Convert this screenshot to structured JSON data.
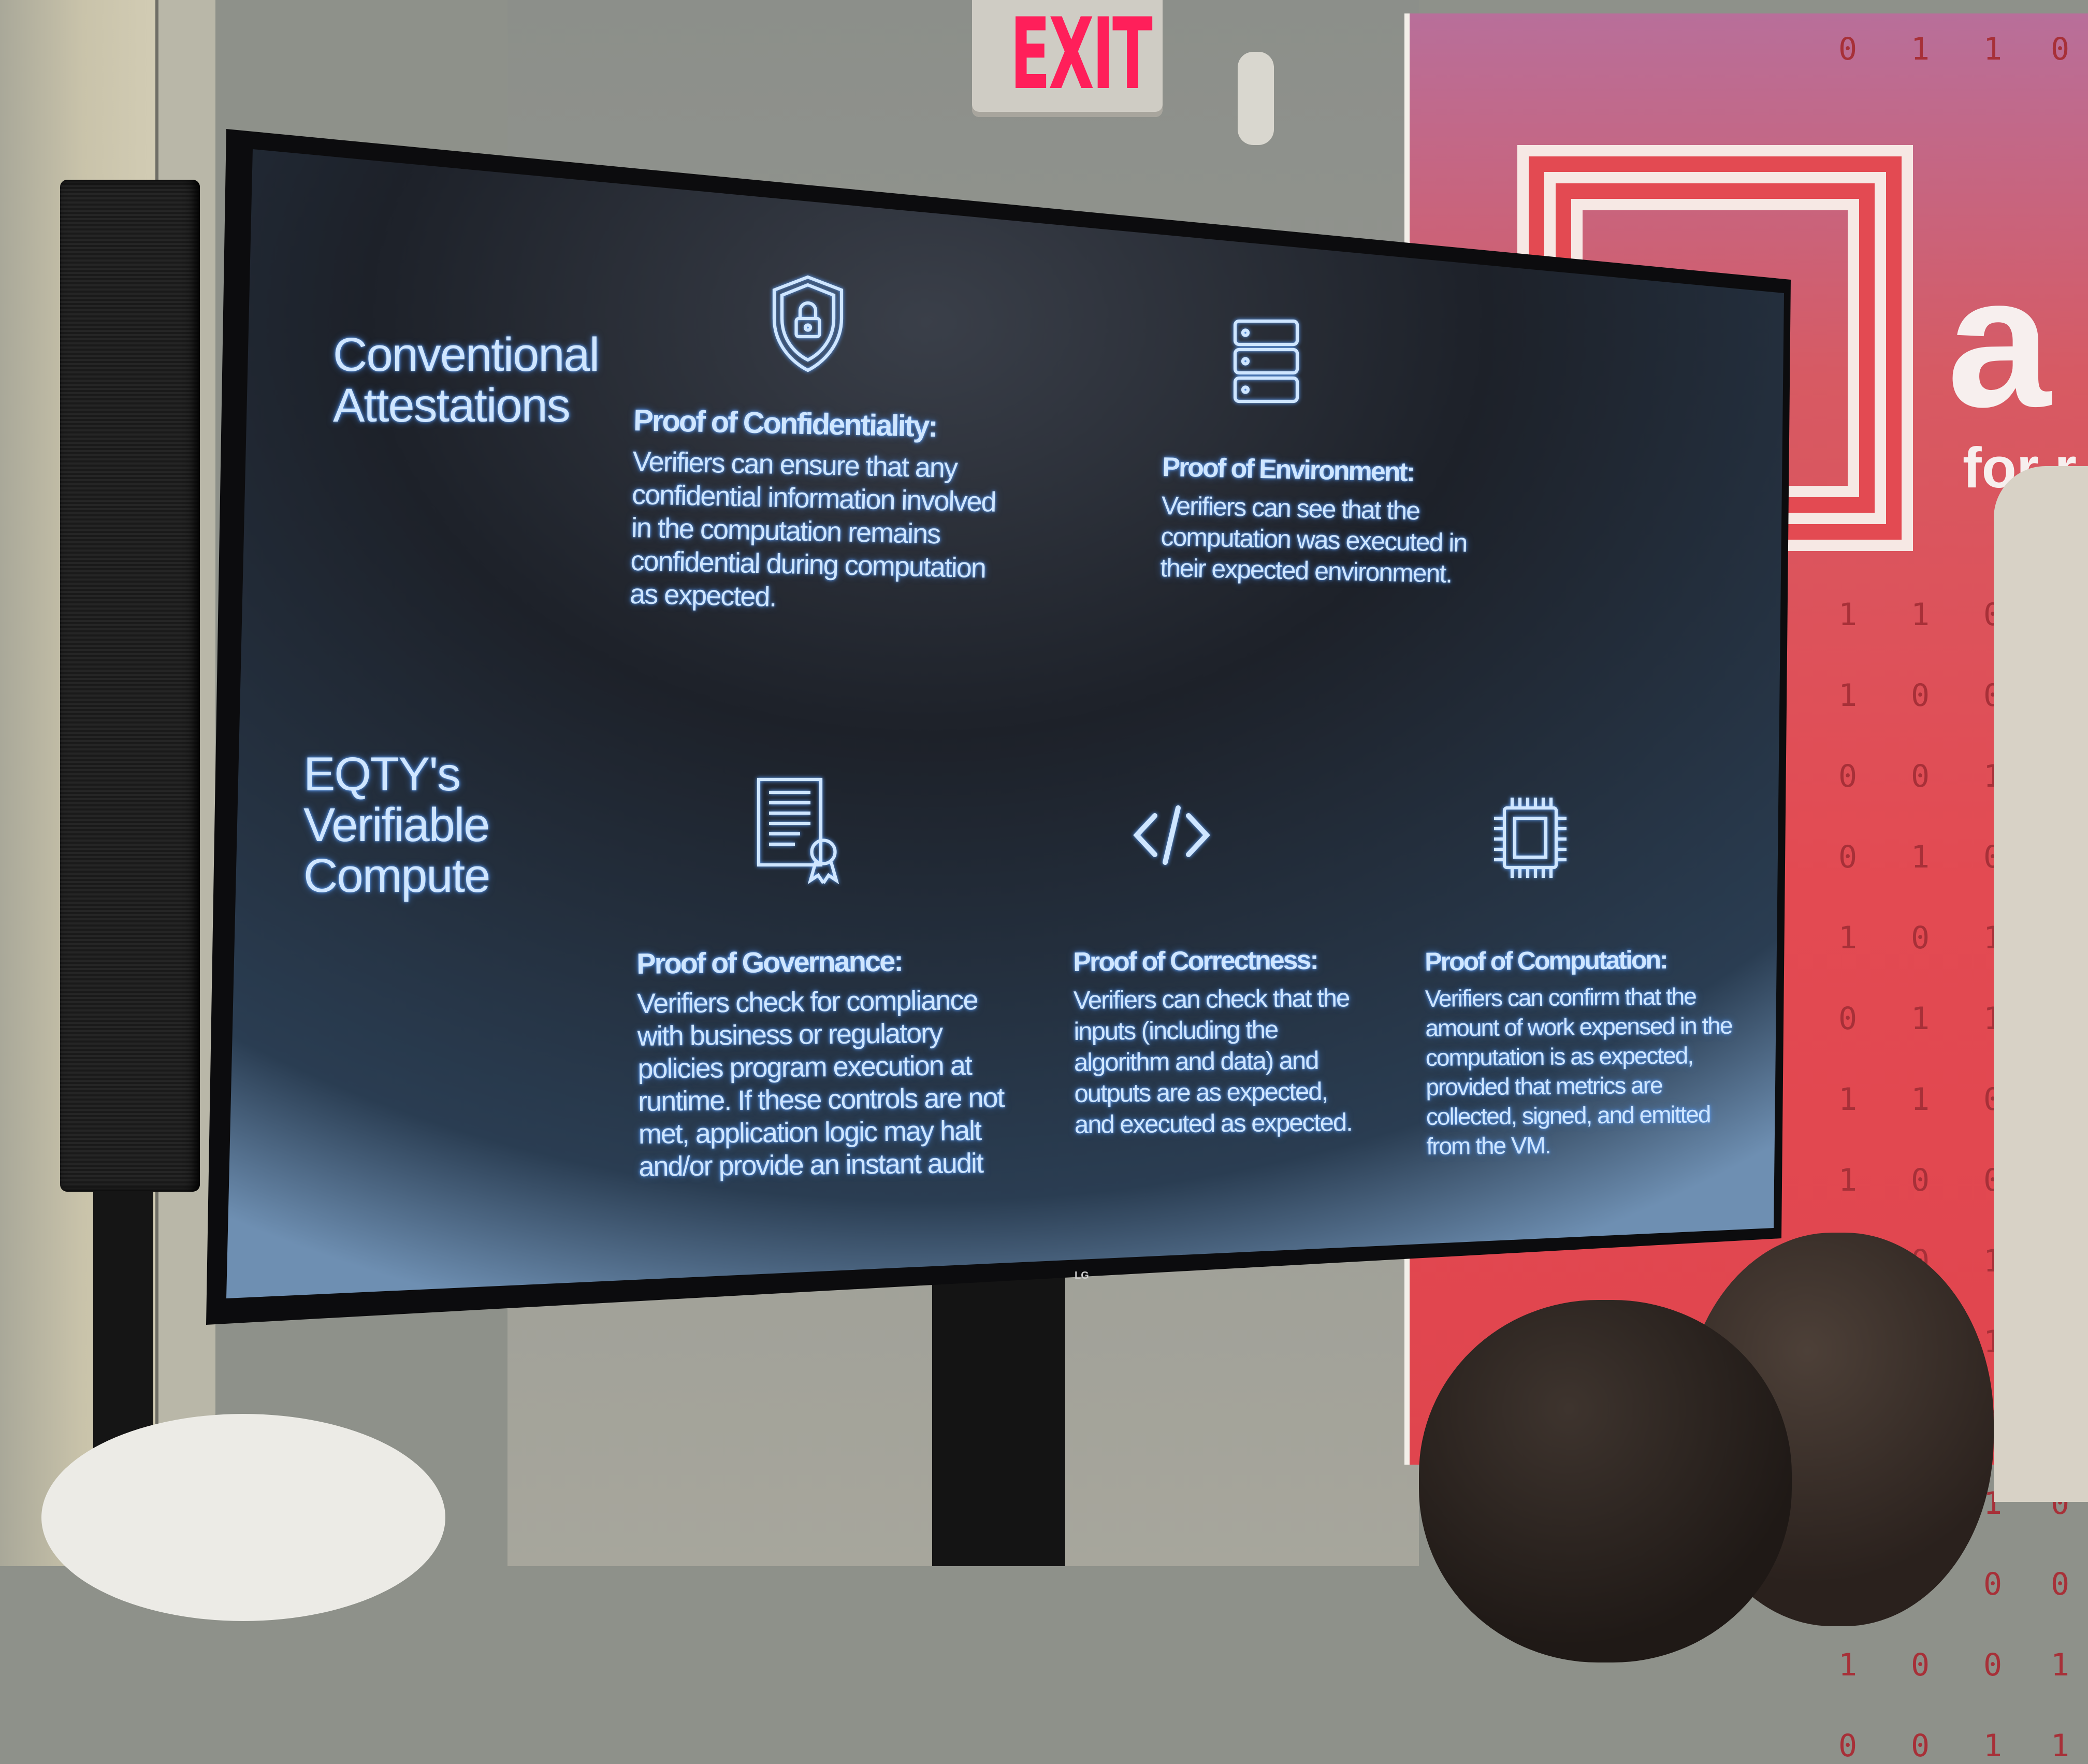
{
  "environment": {
    "exit_sign": "EXIT",
    "banner_partial_text": "a",
    "banner_partial_subtext": "for r",
    "tv_logo": "LG",
    "colors": {
      "exit": "#ff1f5a",
      "banner": "#e34a52",
      "slide_bg": "#1c2029",
      "slide_text": "#cfe6ff"
    }
  },
  "slide": {
    "rows": [
      {
        "heading": [
          "Conventional",
          "Attestations"
        ],
        "items": [
          {
            "icon": "shield-lock-icon",
            "title": "Proof of Confidentiality:",
            "body": [
              "Verifiers can ensure that any",
              "confidential information involved",
              "in the computation remains",
              "confidential during computation",
              "as expected."
            ]
          },
          {
            "icon": "server-stack-icon",
            "title": "Proof of Environment:",
            "body": [
              "Verifiers can see that the",
              "computation was executed in",
              "their expected environment."
            ]
          }
        ]
      },
      {
        "heading": [
          "EQTY's",
          "Verifiable",
          "Compute"
        ],
        "items": [
          {
            "icon": "certificate-document-icon",
            "title": "Proof of Governance:",
            "body": [
              "Verifiers check for compliance",
              "with business or regulatory",
              "policies program execution at",
              "runtime. If these controls are not",
              "met, application logic may halt",
              "and/or provide an instant audit"
            ]
          },
          {
            "icon": "code-brackets-icon",
            "title": "Proof of Correctness:",
            "body": [
              "Verifiers can check that the",
              "inputs (including the",
              "algorithm and data) and",
              "outputs are as expected,",
              "and executed as expected."
            ]
          },
          {
            "icon": "cpu-chip-icon",
            "title": "Proof of Computation:",
            "body": [
              "Verifiers can confirm that the",
              "amount of work expensed in the",
              "computation is as expected,",
              "provided that metrics are",
              "collected, signed, and emitted",
              "from the VM."
            ]
          }
        ]
      }
    ]
  }
}
